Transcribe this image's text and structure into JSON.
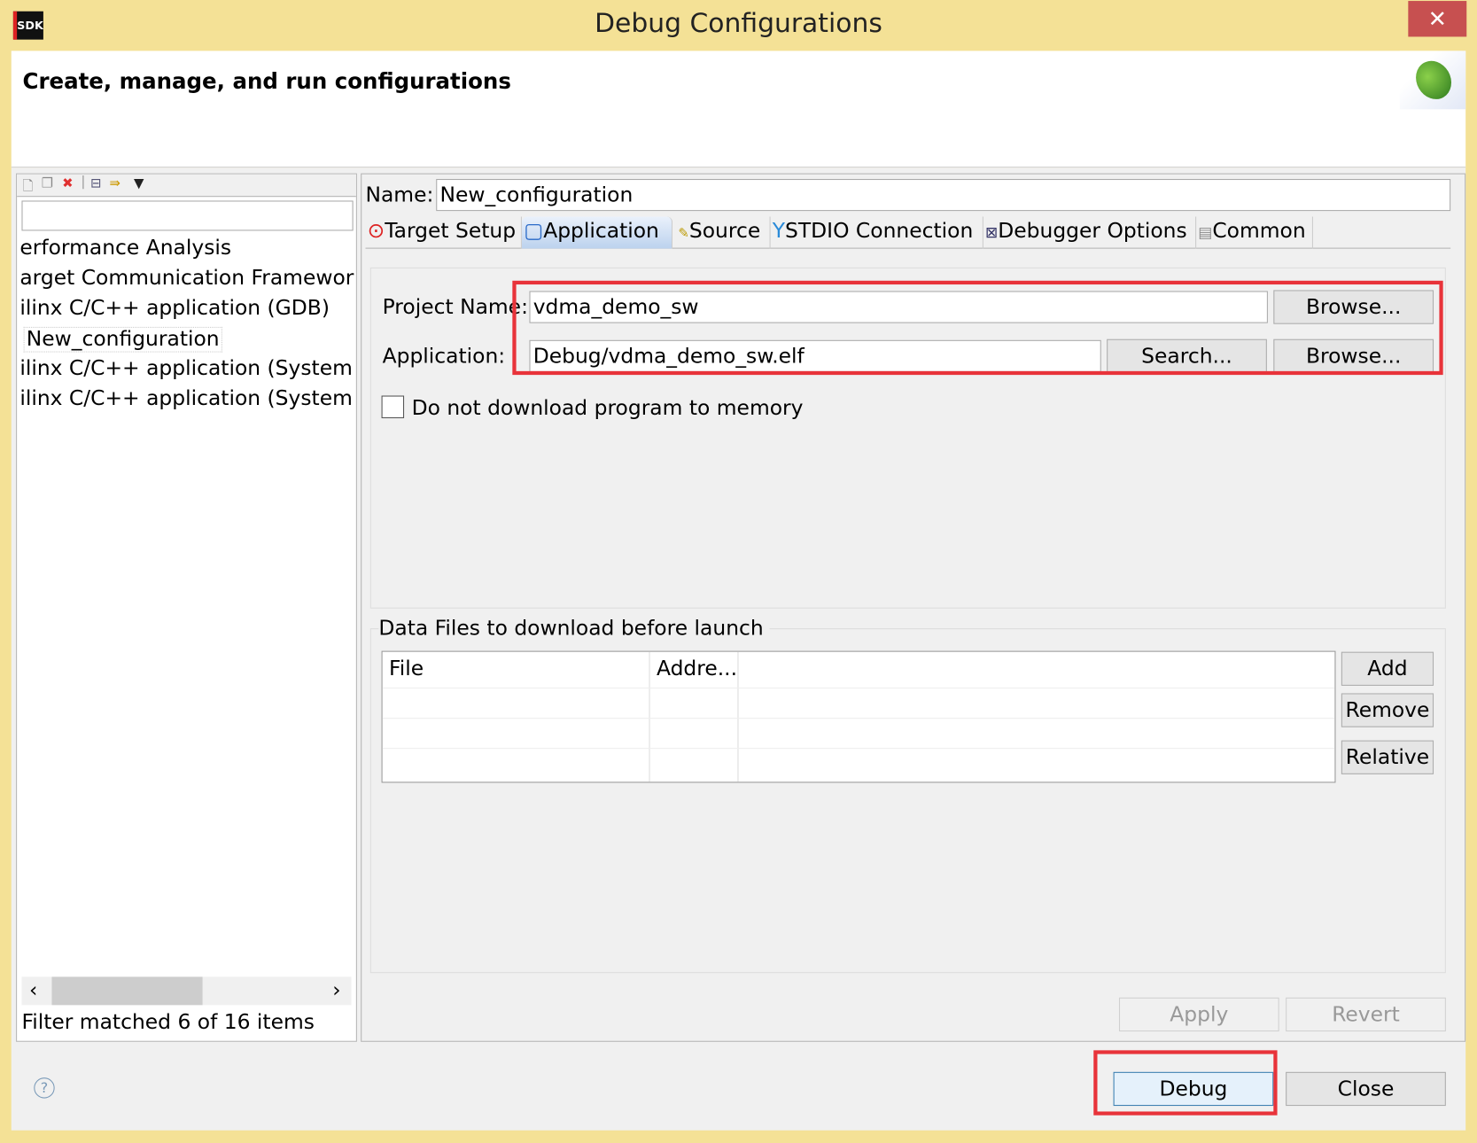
{
  "window": {
    "title": "Debug Configurations",
    "logo": "SDK",
    "close_icon": "close-icon",
    "accent_titlebar": "#f4e196",
    "close_color": "#c75050"
  },
  "header": {
    "title": "Create, manage, and run configurations",
    "icon": "bug-icon"
  },
  "left": {
    "toolbar": [
      "new-configuration-icon",
      "duplicate-icon",
      "delete-icon",
      "collapse-all-icon",
      "filter-icon",
      "view-menu-icon"
    ],
    "filter_value": "",
    "items": [
      "erformance Analysis",
      "arget Communication Framework",
      "ilinx C/C++ application (GDB)",
      "New_configuration",
      "ilinx C/C++ application (System [",
      "ilinx C/C++ application (System ["
    ],
    "status": "Filter matched 6 of 16 items"
  },
  "main": {
    "name_label": "Name:",
    "name_value": "New_configuration",
    "tabs": [
      {
        "label": "Target Setup",
        "icon": "target-icon"
      },
      {
        "label": "Application",
        "icon": "application-icon",
        "active": true
      },
      {
        "label": "Source",
        "icon": "source-icon"
      },
      {
        "label": "STDIO Connection",
        "icon": "connection-icon"
      },
      {
        "label": "Debugger Options",
        "icon": "debugger-icon"
      },
      {
        "label": "Common",
        "icon": "common-icon"
      }
    ],
    "project_label": "Project Name:",
    "project_value": "vdma_demo_sw",
    "application_label": "Application:",
    "application_value": "Debug/vdma_demo_sw.elf",
    "browse": "Browse...",
    "search": "Search...",
    "no_download_label": "Do not download program to memory",
    "no_download_checked": false,
    "data_files_label": "Data Files to download before launch",
    "columns": [
      "File",
      "Addre..."
    ],
    "add": "Add",
    "remove": "Remove",
    "relative": "Relative",
    "apply": "Apply",
    "revert": "Revert"
  },
  "footer": {
    "debug": "Debug",
    "close": "Close",
    "help_icon": "help-icon"
  },
  "highlight_color": "#e8333a"
}
